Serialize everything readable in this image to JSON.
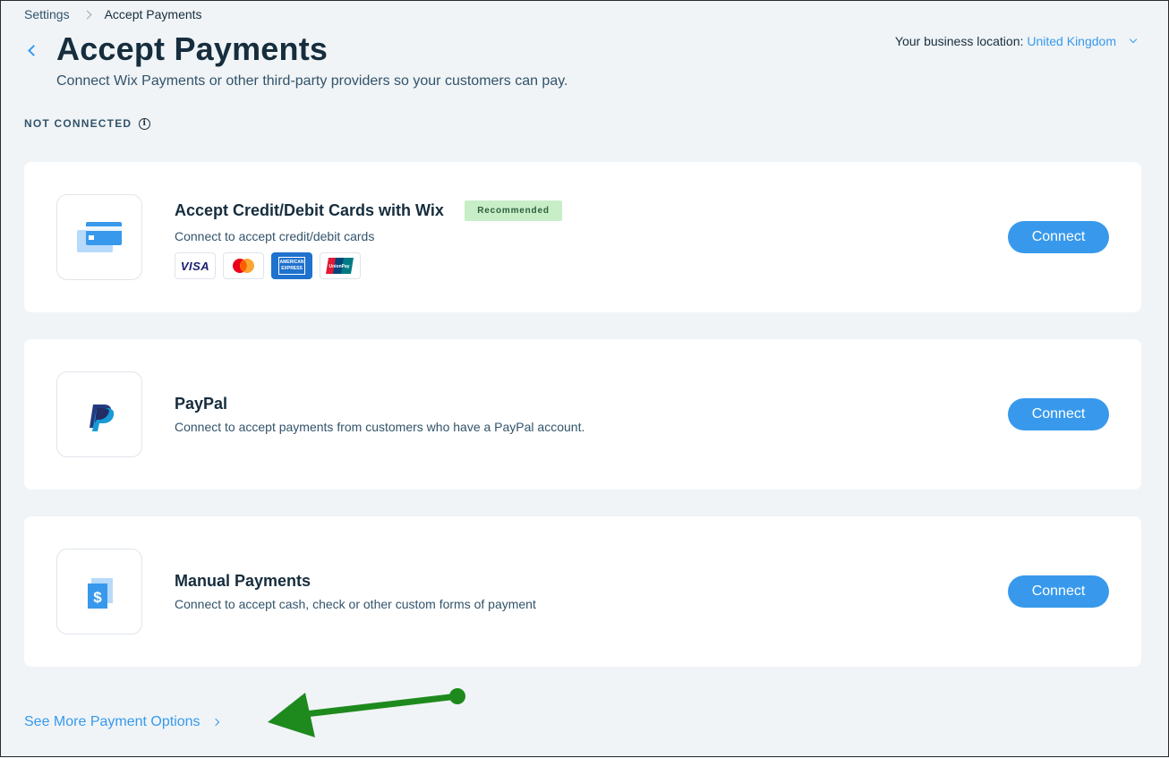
{
  "breadcrumb": {
    "parent": "Settings",
    "current": "Accept Payments"
  },
  "header": {
    "title": "Accept Payments",
    "subtitle": "Connect Wix Payments or other third-party providers so your customers can pay.",
    "location_label": "Your business location:",
    "location_value": "United Kingdom"
  },
  "section": {
    "label": "NOT CONNECTED",
    "info_icon": "info-icon"
  },
  "providers": [
    {
      "title": "Accept Credit/Debit Cards with Wix",
      "badge": "Recommended",
      "description": "Connect to accept credit/debit cards",
      "icon": "credit-card-icon",
      "card_logos": [
        "VISA",
        "Mastercard",
        "AMERICAN EXPRESS",
        "UnionPay"
      ],
      "button": "Connect"
    },
    {
      "title": "PayPal",
      "description": "Connect to accept payments from customers who have a PayPal account.",
      "icon": "paypal-icon",
      "button": "Connect"
    },
    {
      "title": "Manual Payments",
      "description": "Connect to accept cash, check or other custom forms of payment",
      "icon": "dollar-bill-icon",
      "button": "Connect"
    }
  ],
  "footer": {
    "see_more": "See More Payment Options"
  },
  "colors": {
    "accent": "#3899ec",
    "annotation_arrow": "#1e8a1e",
    "badge_bg": "#c8eec8"
  }
}
